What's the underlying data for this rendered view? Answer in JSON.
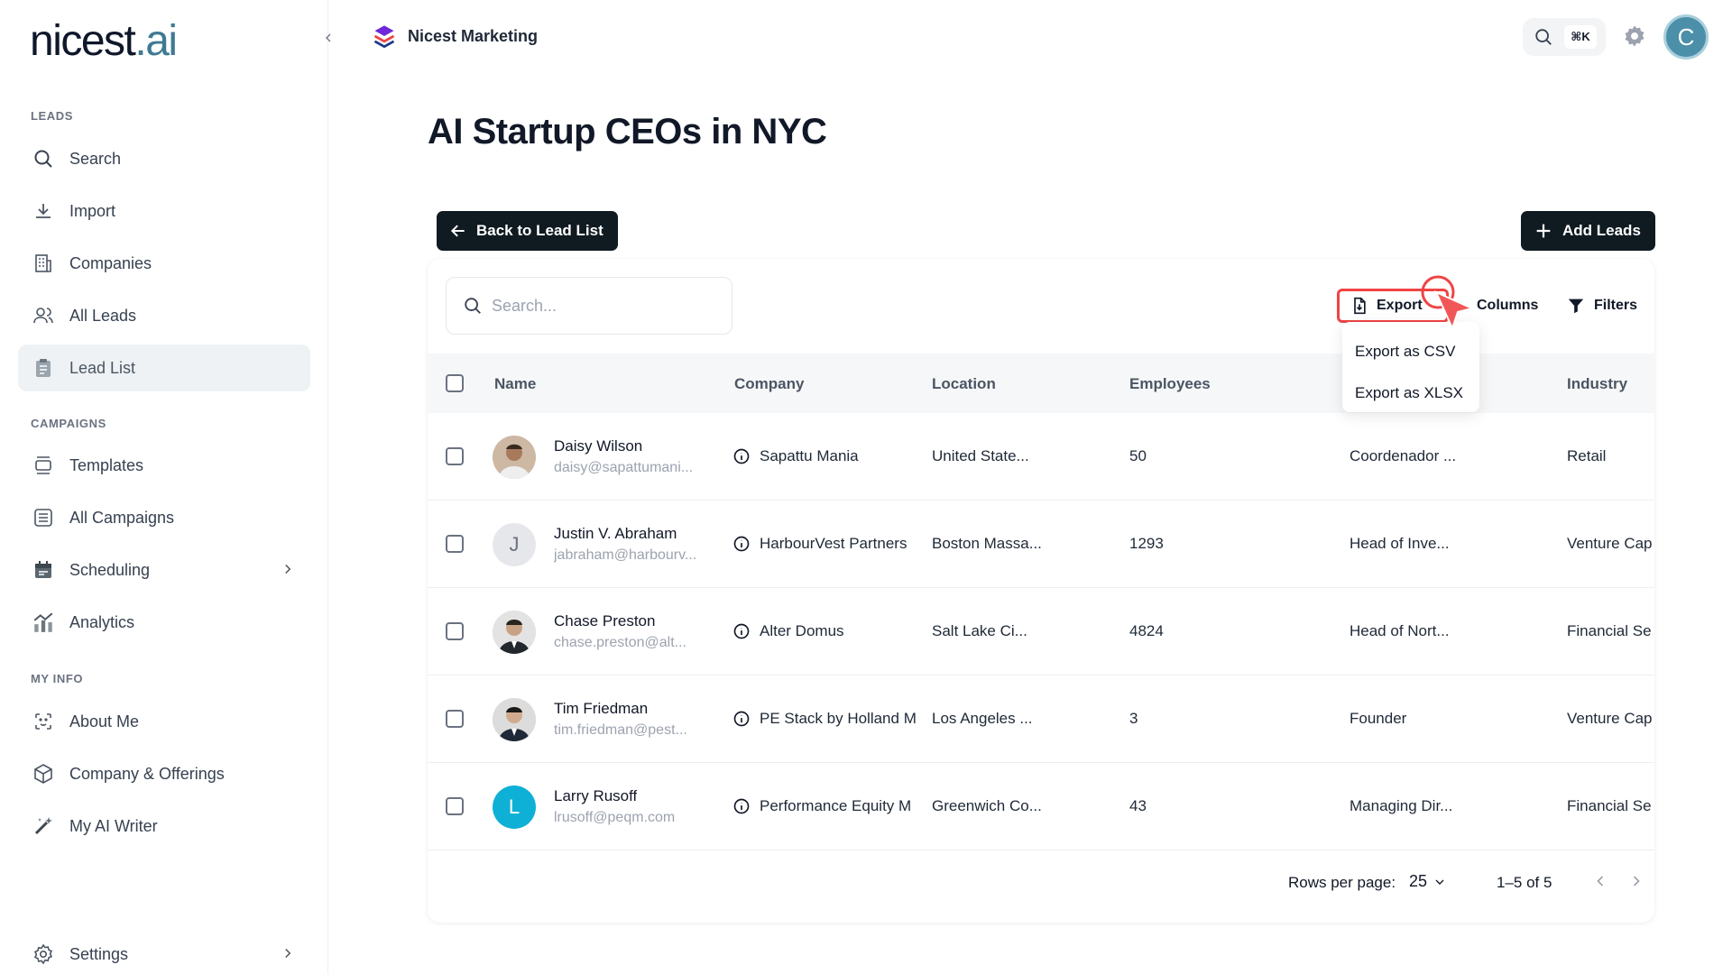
{
  "sidebar": {
    "logo": {
      "main": "nicest",
      "dot": ".",
      "accent": "ai"
    },
    "sections": {
      "leads": "LEADS",
      "campaigns": "CAMPAIGNS",
      "my_info": "MY INFO"
    },
    "items": {
      "search": "Search",
      "import": "Import",
      "companies": "Companies",
      "all_leads": "All Leads",
      "lead_list": "Lead List",
      "templates": "Templates",
      "all_campaigns": "All Campaigns",
      "scheduling": "Scheduling",
      "analytics": "Analytics",
      "about_me": "About Me",
      "company_offerings": "Company & Offerings",
      "my_ai_writer": "My AI Writer",
      "settings": "Settings"
    },
    "active_item": "lead_list"
  },
  "topbar": {
    "workspace": "Nicest Marketing",
    "shortcut": "⌘K",
    "user_initial": "C"
  },
  "page": {
    "title": "AI Startup CEOs in NYC",
    "back_button": "Back to Lead List",
    "add_button": "Add Leads"
  },
  "toolbar": {
    "search_placeholder": "Search...",
    "export": "Export",
    "columns": "Columns",
    "filters": "Filters",
    "export_menu": [
      "Export as CSV",
      "Export as XLSX"
    ]
  },
  "table": {
    "headers": {
      "name": "Name",
      "company": "Company",
      "location": "Location",
      "employees": "Employees",
      "industry": "Industry"
    },
    "rows": [
      {
        "name": "Daisy Wilson",
        "email": "daisy@sapattumani...",
        "company": "Sapattu Mania",
        "location": "United State...",
        "employees": "50",
        "title": "Coordenador ...",
        "industry": "Retail",
        "avatar": "photo"
      },
      {
        "name": "Justin V. Abraham",
        "email": "jabraham@harbourv...",
        "company": "HarbourVest Partners",
        "location": "Boston Massa...",
        "employees": "1293",
        "title": "Head of Inve...",
        "industry": "Venture Cap",
        "avatar": "J"
      },
      {
        "name": "Chase Preston",
        "email": "chase.preston@alt...",
        "company": "Alter Domus",
        "location": "Salt Lake Ci...",
        "employees": "4824",
        "title": "Head of Nort...",
        "industry": "Financial Se",
        "avatar": "photo"
      },
      {
        "name": "Tim Friedman",
        "email": "tim.friedman@pest...",
        "company": "PE Stack by Holland M",
        "location": "Los Angeles ...",
        "employees": "3",
        "title": "Founder",
        "industry": "Venture Cap",
        "avatar": "photo"
      },
      {
        "name": "Larry Rusoff",
        "email": "lrusoff@peqm.com",
        "company": "Performance Equity M",
        "location": "Greenwich Co...",
        "employees": "43",
        "title": "Managing Dir...",
        "industry": "Financial Se",
        "avatar": "L"
      }
    ]
  },
  "pagination": {
    "rows_per_page_label": "Rows per page:",
    "rows_per_page_value": "25",
    "range": "1–5 of 5"
  },
  "colors": {
    "primary_dark": "#0f1a21",
    "accent": "#3f7a93",
    "highlight": "#ef4444",
    "avatar_blue": "#0fb0d6"
  }
}
